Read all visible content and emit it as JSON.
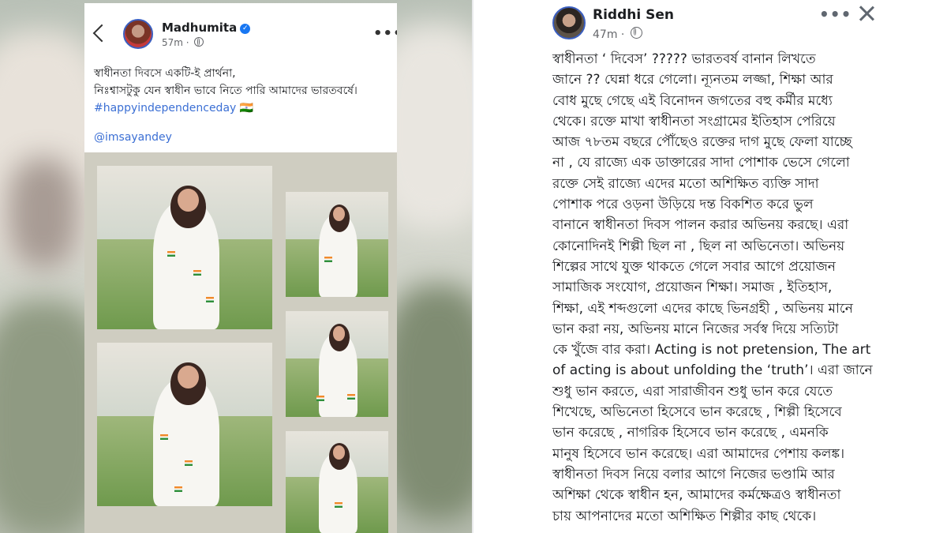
{
  "left_post": {
    "author": "Madhumita",
    "time": "57m",
    "lines": [
      "স্বাধীনতা দিবসে একটি-ই প্রার্থনা,",
      "নিঃশ্বাসটুকু যেন স্বাধীন ভাবে নিতে পারি আমাদের ভারতবর্ষে।"
    ],
    "hashtag": "#happyindependenceday 🇮🇳",
    "mention": "@imsayandey"
  },
  "right_post": {
    "author": "Riddhi Sen",
    "time": "47m",
    "lines": [
      "স্বাধীনতা ‘ দিবেস’ ????? ভারতবর্ষ বানান লিখতে",
      "জানে ?? ঘেন্না ধরে গেলো। ন্যূনতম লজ্জা, শিক্ষা আর",
      "বোধ মুছে গেছে এই বিনোদন জগতের বহু কর্মীর মধ্যে",
      "থেকে। রক্তে মাখা স্বাধীনতা সংগ্রামের ইতিহাস পেরিয়ে",
      "আজ ৭৮তম বছরে পৌঁছেও রক্তের দাগ মুছে ফেলা যাচ্ছে",
      "না , যে রাজ্যে এক ডাক্তারের সাদা পোশাক ভেসে গেলো",
      "রক্তে সেই রাজ্যে এদের মতো অশিক্ষিত ব্যক্তি সাদা",
      "পোশাক পরে ওড়না উড়িয়ে দন্ত বিকশিত করে ভুল",
      "বানানে স্বাধীনতা দিবস পালন করার অভিনয় করছে। এরা",
      "কোনোদিনই শিল্পী ছিল না , ছিল না অভিনেতা। অভিনয়",
      "শিল্পের সাথে যুক্ত থাকতে গেলে সবার আগে প্রয়োজন",
      "সামাজিক সংযোগ, প্রয়োজন শিক্ষা। সমাজ , ইতিহাস,",
      "শিক্ষা, এই শব্দগুলো এদের কাছে ভিনগ্রহী , অভিনয় মানে",
      "ভান করা নয়, অভিনয় মানে নিজের সর্বস্ব দিয়ে সত্যিটা",
      "কে খুঁজে বার করা। Acting is not pretension, The art",
      "of acting is about unfolding the ‘truth’। এরা জানে",
      "শুধু ভান করতে, এরা সারাজীবন শুধু ভান করে যেতে",
      "শিখেছে, অভিনেতা হিসেবে ভান করেছে , শিল্পী হিসেবে",
      "ভান করেছে , নাগরিক হিসেবে ভান করেছে , এমনকি",
      "মানুষ হিসেবে ভান করেছে। এরা আমাদের পেশায় কলঙ্ক।",
      "স্বাধীনতা দিবস নিয়ে বলার আগে নিজের ভণ্ডামি আর",
      "অশিক্ষা থেকে স্বাধীন হন, আমাদের কর্মক্ষেত্রও স্বাধীনতা",
      "চায় আপনাদের মতো অশিক্ষিত শিল্পীর কাছ থেকে।"
    ]
  },
  "icons": {
    "back": "back-arrow-icon",
    "verified": "verified-badge-icon",
    "globe": "globe-icon",
    "more": "more-options-icon",
    "close": "close-icon"
  },
  "colors": {
    "link": "#3b6fd4",
    "verified": "#1877f2",
    "text": "#1c1e21",
    "meta": "#65676b"
  }
}
